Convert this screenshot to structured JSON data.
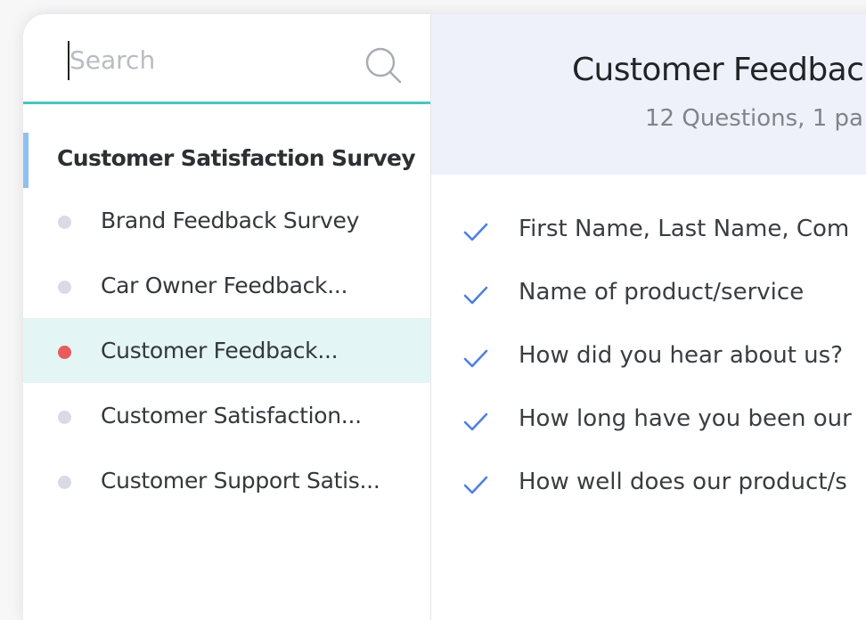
{
  "search": {
    "placeholder": "Search",
    "value": ""
  },
  "sidebar": {
    "category_title": "Customer Satisfaction Survey",
    "items": [
      {
        "label": "Brand Feedback Survey",
        "active": false
      },
      {
        "label": "Car Owner Feedback...",
        "active": false
      },
      {
        "label": "Customer Feedback...",
        "active": true
      },
      {
        "label": "Customer Satisfaction...",
        "active": false
      },
      {
        "label": "Customer Support  Satis...",
        "active": false
      }
    ]
  },
  "main": {
    "title": "Customer Feedbac",
    "subtitle": "12 Questions, 1 pa",
    "questions": [
      "First Name, Last Name, Com",
      "Name of product/service",
      "How did you hear about us?",
      "How long have you been our",
      "How well does our product/s"
    ]
  },
  "colors": {
    "accent_teal": "#4cc3c3",
    "active_bullet": "#e85c5c",
    "inactive_bullet": "#d8dbe6",
    "check": "#4f7fe0",
    "category_marker": "#8ec0f3",
    "active_row": "#e3f5f4",
    "header_bg": "#eef1fa"
  },
  "icons": {
    "search": "search-icon",
    "check": "check-icon"
  }
}
